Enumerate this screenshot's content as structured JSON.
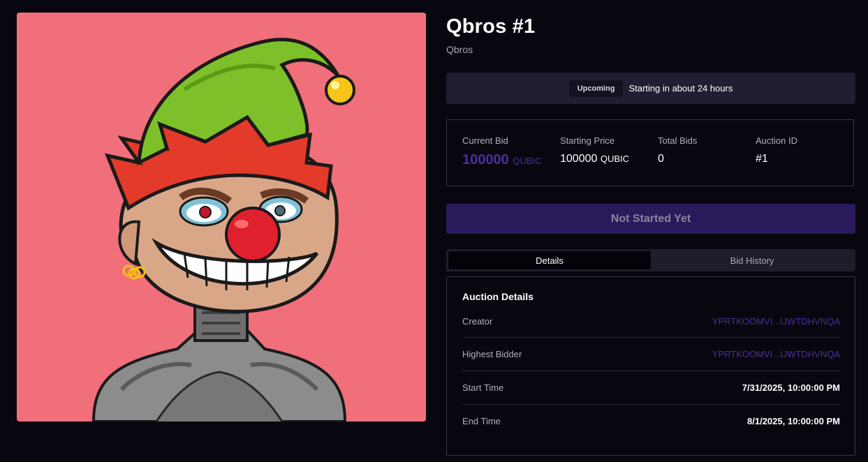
{
  "nft": {
    "title": "Qbros #1",
    "collection": "Qbros",
    "image_alt": "Jester character with green elf hat, red nose and wide grin"
  },
  "status": {
    "badge": "Upcoming",
    "text": "Starting in about 24 hours"
  },
  "stats": {
    "current_bid_label": "Current Bid",
    "current_bid_value": "100000",
    "current_bid_unit": "QUBIC",
    "starting_price_label": "Starting Price",
    "starting_price_value": "100000",
    "starting_price_unit": "QUBIC",
    "total_bids_label": "Total Bids",
    "total_bids_value": "0",
    "auction_id_label": "Auction ID",
    "auction_id_value": "#1"
  },
  "action_button": "Not Started Yet",
  "tabs": [
    {
      "label": "Details",
      "active": true
    },
    {
      "label": "Bid History",
      "active": false
    }
  ],
  "details": {
    "title": "Auction Details",
    "rows": [
      {
        "label": "Creator",
        "value": "YPRTKOOMVI...IJWTDHVNQA"
      },
      {
        "label": "Highest Bidder",
        "value": "YPRTKOOMVI...IJWTDHVNQA"
      },
      {
        "label": "Start Time",
        "value": "7/31/2025, 10:00:00 PM"
      },
      {
        "label": "End Time",
        "value": "8/1/2025, 10:00:00 PM"
      }
    ]
  },
  "colors": {
    "background": "#08070f",
    "art_background": "#f06f7a",
    "accent": "#4b2f9a",
    "button": "#2a1a5c"
  }
}
